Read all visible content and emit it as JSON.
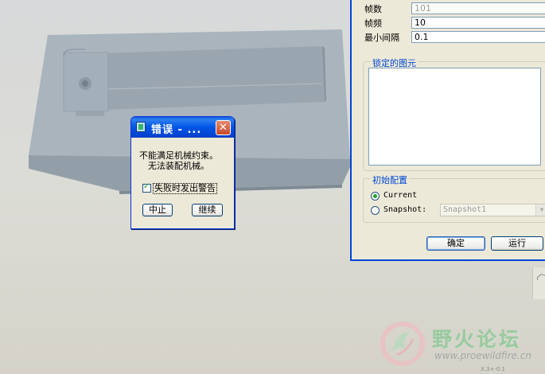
{
  "error_dialog": {
    "title": "错误 - ...",
    "close_icon": "close-icon",
    "message_line1": "不能满足机械约束。",
    "message_line2": "无法装配机械。",
    "warn_checkbox_label": "失败时发出警告",
    "warn_checked": true,
    "abort_label": "中止",
    "continue_label": "继续"
  },
  "panel": {
    "frames_label": "帧数",
    "frames_value": "101",
    "frame_rate_label": "帧频",
    "frame_rate_value": "10",
    "min_interval_label": "最小间隔",
    "min_interval_value": "0.1",
    "locked_group_label": "锁定的图元",
    "init_group_label": "初始配置",
    "radio_current": "Current",
    "radio_snapshot": "Snapshot:",
    "snapshot_select_value": "Snapshot1",
    "selected_config": "Current",
    "ok_label": "确定",
    "run_label": "运行"
  },
  "watermark": {
    "site_name": "野火论坛",
    "url": "www.proewildfire.cn"
  },
  "coord_readout": "X.3+-0.1",
  "colors": {
    "model_fill": "#a9b4bd",
    "xp_title_blue": "#0055e5",
    "dialog_bg": "#ece9d8"
  }
}
